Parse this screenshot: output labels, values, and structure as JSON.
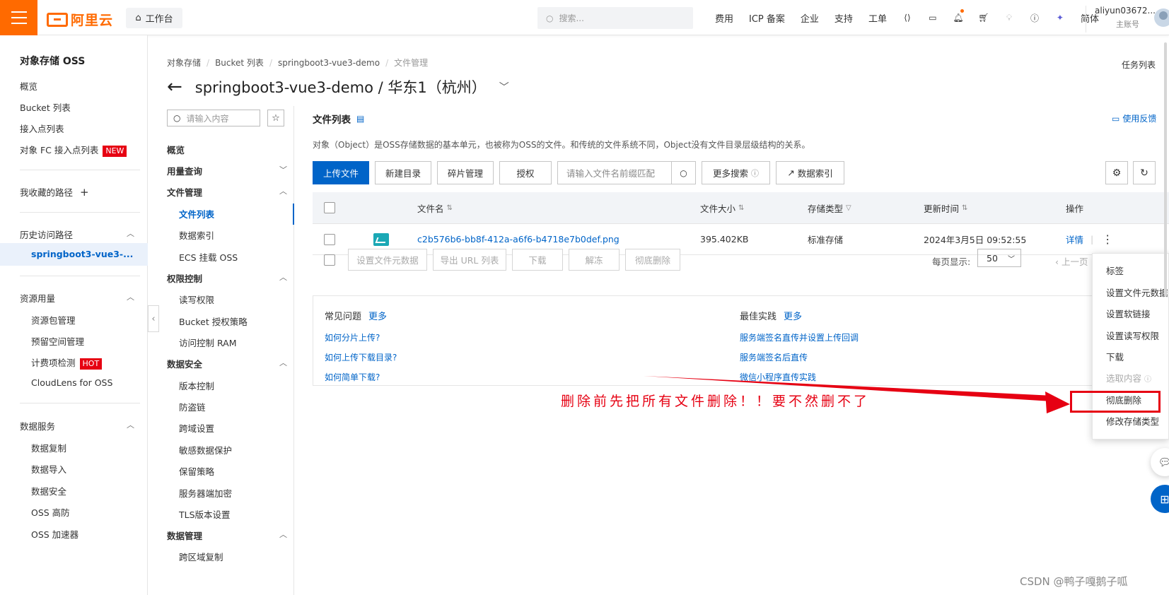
{
  "topbar": {
    "logo_text": "阿里云",
    "workbench_label": "工作台",
    "search_placeholder": "搜索...",
    "links": [
      "费用",
      "ICP 备案",
      "企业",
      "支持",
      "工单"
    ],
    "lang": "简体",
    "user_name": "aliyun03672...",
    "user_role": "主账号",
    "accent": "#ff6a00"
  },
  "sidenav": {
    "title": "对象存储 OSS",
    "items": [
      "概览",
      "Bucket 列表",
      "接入点列表"
    ],
    "fc_item": "对象 FC 接入点列表",
    "fc_badge": "NEW",
    "favorites": "我收藏的路径",
    "history": "历史访问路径",
    "history_active": "springboot3-vue3-...",
    "resource_title": "资源用量",
    "resource_items": [
      "资源包管理",
      "预留空间管理"
    ],
    "billing_item": "计费项检测",
    "billing_badge": "HOT",
    "cloudlens_item": "CloudLens for OSS",
    "data_services_title": "数据服务",
    "data_services_items": [
      "数据复制",
      "数据导入",
      "数据安全",
      "OSS 高防",
      "OSS 加速器"
    ]
  },
  "breadcrumb": [
    "对象存储",
    "Bucket 列表",
    "springboot3-vue3-demo",
    "文件管理"
  ],
  "task_list": "任务列表",
  "page_title": "springboot3-vue3-demo / 华东1（杭州）",
  "innernav": {
    "search_placeholder": "请输入内容",
    "overview": "概览",
    "usage": "用量查询",
    "file_mgmt": "文件管理",
    "file_mgmt_items": [
      "文件列表",
      "数据索引",
      "ECS 挂载 OSS"
    ],
    "perm": "权限控制",
    "perm_items": [
      "读写权限",
      "Bucket 授权策略",
      "访问控制 RAM"
    ],
    "security": "数据安全",
    "security_items": [
      "版本控制",
      "防盗链",
      "跨域设置",
      "敏感数据保护",
      "保留策略",
      "服务器端加密",
      "TLS版本设置"
    ],
    "data_mgmt": "数据管理",
    "data_mgmt_items": [
      "跨区域复制"
    ]
  },
  "content": {
    "title": "文件列表",
    "feedback": "使用反馈",
    "description": "对象（Object）是OSS存储数据的基本单元，也被称为OSS的文件。和传统的文件系统不同，Object没有文件目录层级结构的关系。",
    "toolbar": {
      "upload": "上传文件",
      "new_dir": "新建目录",
      "fragments": "碎片管理",
      "authorize": "授权",
      "filter_placeholder": "请输入文件名前缀匹配",
      "more_search": "更多搜索",
      "data_index": "数据索引"
    },
    "table": {
      "headers": [
        "文件名",
        "文件大小",
        "存储类型",
        "更新时间",
        "操作"
      ],
      "rows": [
        {
          "name": "c2b576b6-bb8f-412a-a6f6-b4718e7b0def.png",
          "size": "395.402KB",
          "storage": "标准存储",
          "updated": "2024年3月5日 09:52:55",
          "action": "详情"
        }
      ]
    },
    "bulk": [
      "设置文件元数据",
      "导出 URL 列表",
      "下载",
      "解冻",
      "彻底删除"
    ],
    "per_page_label": "每页显示:",
    "per_page_value": "50",
    "prev_page": "上一页",
    "faq": {
      "common_title": "常见问题",
      "best_title": "最佳实践",
      "more": "更多",
      "common_links": [
        "如何分片上传?",
        "如何上传下载目录?",
        "如何简单下载?"
      ],
      "best_links": [
        "服务端签名直传并设置上传回调",
        "服务端签名后直传",
        "微信小程序直传实践"
      ]
    }
  },
  "context_menu": {
    "items": [
      "标签",
      "设置文件元数据",
      "设置软链接",
      "设置读写权限",
      "下载",
      "选取内容",
      "彻底删除",
      "修改存储类型"
    ],
    "disabled": [
      "选取内容"
    ],
    "highlight": "彻底删除"
  },
  "annotation": {
    "text": "删除前先把所有文件删除！！要不然删不了",
    "color": "#e60012"
  },
  "watermark": "CSDN @鸭子嘎鹅子呱",
  "colors": {
    "primary": "#0064c8",
    "orange": "#ff6a00",
    "red": "#e60012"
  }
}
